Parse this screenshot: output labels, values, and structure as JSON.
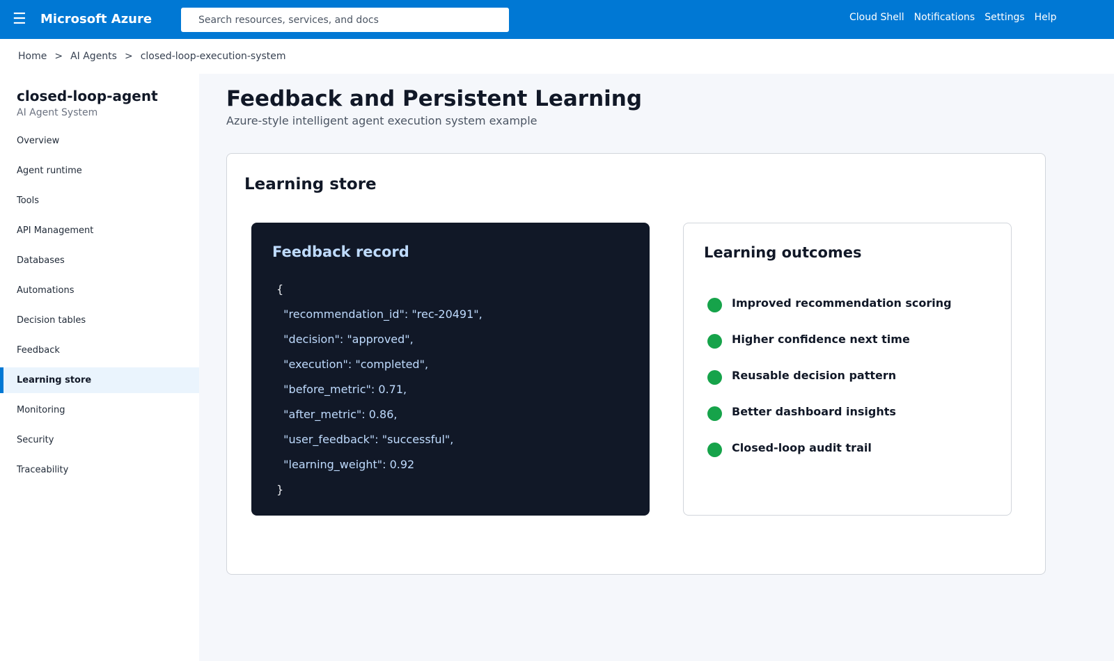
{
  "header": {
    "menu_glyph": "☰",
    "brand": "Microsoft Azure",
    "search_placeholder": "Search resources, services, and docs",
    "links": [
      "Cloud Shell",
      "Notifications",
      "Settings",
      "Help"
    ],
    "accent_color": "#0078d4"
  },
  "breadcrumb": {
    "items": [
      "Home",
      "AI Agents",
      "closed-loop-execution-system"
    ],
    "separator": ">"
  },
  "sidebar": {
    "resource_name": "closed-loop-agent",
    "resource_type": "AI Agent System",
    "items": [
      {
        "label": "Overview"
      },
      {
        "label": "Agent runtime"
      },
      {
        "label": "Tools"
      },
      {
        "label": "API Management"
      },
      {
        "label": "Databases"
      },
      {
        "label": "Automations"
      },
      {
        "label": "Decision tables"
      },
      {
        "label": "Feedback"
      },
      {
        "label": "Learning store",
        "active": true
      },
      {
        "label": "Monitoring"
      },
      {
        "label": "Security"
      },
      {
        "label": "Traceability"
      }
    ]
  },
  "page": {
    "title": "Feedback and Persistent Learning",
    "subtitle": "Azure-style intelligent agent execution system example"
  },
  "card": {
    "title": "Learning store",
    "feedback_record": {
      "title": "Feedback record",
      "lines": [
        "{",
        "  \"recommendation_id\": \"rec-20491\",",
        "  \"decision\": \"approved\",",
        "  \"execution\": \"completed\",",
        "  \"before_metric\": 0.71,",
        "  \"after_metric\": 0.86,",
        "  \"user_feedback\": \"successful\",",
        "  \"learning_weight\": 0.92",
        "}"
      ]
    },
    "learning_outcomes": {
      "title": "Learning outcomes",
      "bullet_color": "#16a34a",
      "items": [
        "Improved recommendation scoring",
        "Higher confidence next time",
        "Reusable decision pattern",
        "Better dashboard insights",
        "Closed-loop audit trail"
      ]
    }
  }
}
